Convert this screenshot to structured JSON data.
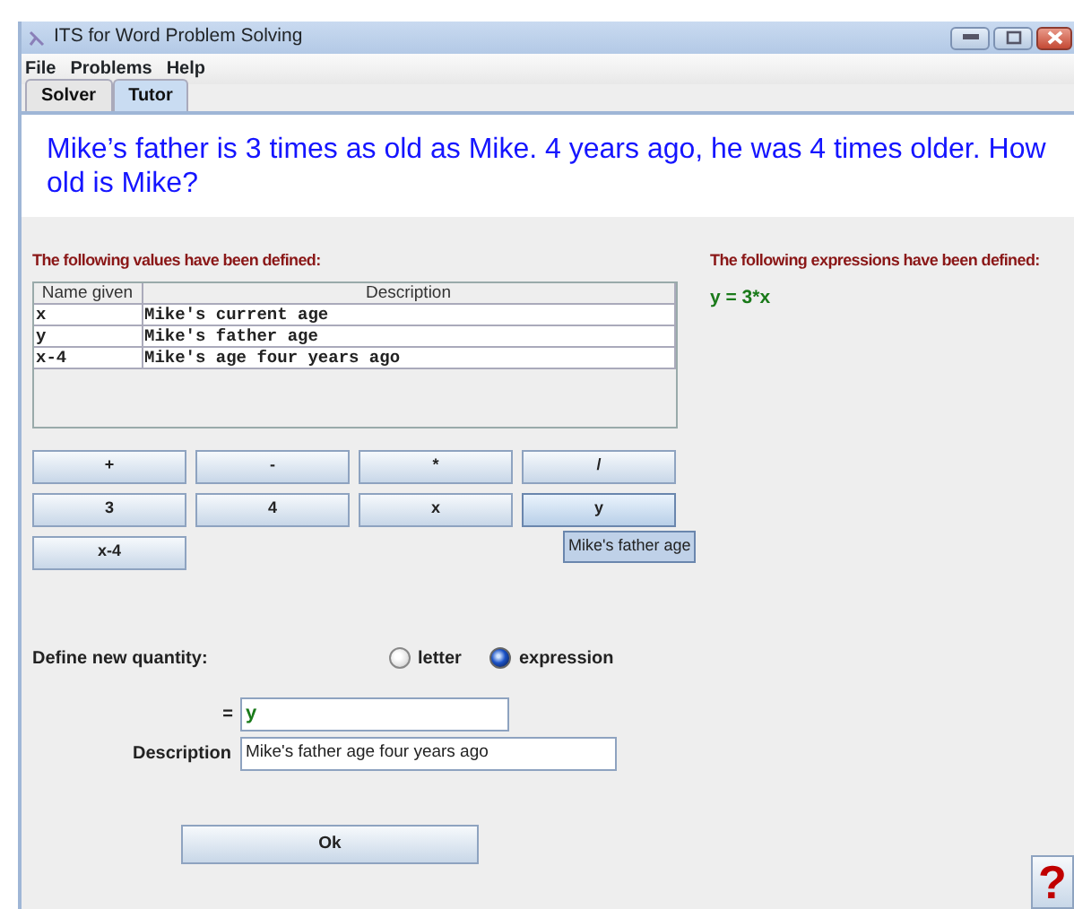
{
  "window": {
    "title": "ITS for Word Problem Solving"
  },
  "menu": [
    "File",
    "Problems",
    "Help"
  ],
  "tabs": [
    {
      "label": "Solver",
      "selected": false
    },
    {
      "label": "Tutor",
      "selected": true
    }
  ],
  "problem": "Mike’s father is 3 times as old as Mike. 4 years ago, he was 4 times older. How old is Mike?",
  "values_heading": "The following values have been defined:",
  "values_table": {
    "columns": [
      "Name given",
      "Description"
    ],
    "rows": [
      [
        "x",
        "Mike's current age"
      ],
      [
        "y",
        "Mike's father age"
      ],
      [
        "x-4",
        "Mike's age four years ago"
      ]
    ]
  },
  "expressions_heading": "The following expressions have been defined:",
  "expressions": [
    "y = 3*x"
  ],
  "keypad": [
    {
      "label": "+",
      "hovered": false
    },
    {
      "label": "-",
      "hovered": false
    },
    {
      "label": "*",
      "hovered": false
    },
    {
      "label": "/",
      "hovered": false
    },
    {
      "label": "3",
      "hovered": false
    },
    {
      "label": "4",
      "hovered": false
    },
    {
      "label": "x",
      "hovered": false
    },
    {
      "label": "y",
      "hovered": true
    },
    {
      "label": "x-4",
      "hovered": false
    }
  ],
  "tooltip": "Mike's father age",
  "define": {
    "label": "Define new quantity:",
    "options": [
      {
        "label": "letter",
        "selected": false
      },
      {
        "label": "expression",
        "selected": true
      }
    ]
  },
  "equals_label": "=",
  "equals_value": "y",
  "description_label": "Description",
  "description_value": "Mike's father age four years ago",
  "ok_button": "Ok",
  "help_button": "?"
}
